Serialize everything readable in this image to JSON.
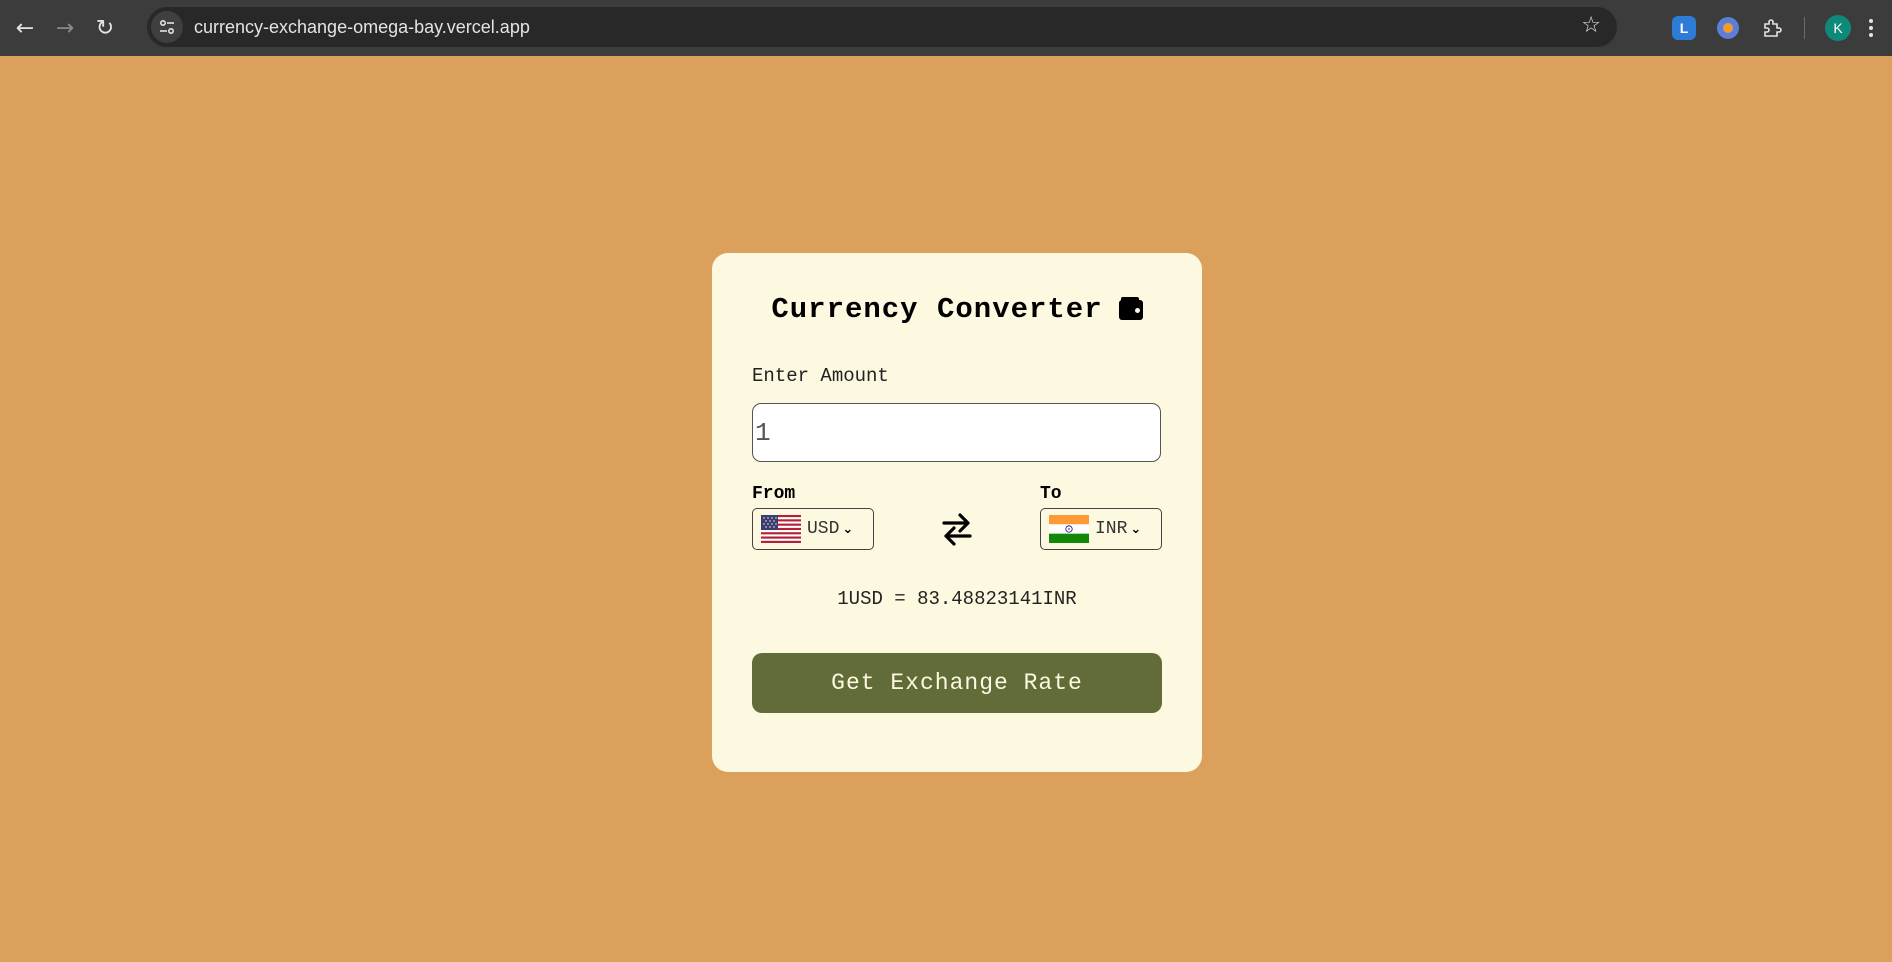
{
  "browser": {
    "url": "currency-exchange-omega-bay.vercel.app",
    "back_icon": "arrow-left-icon",
    "forward_icon": "arrow-right-icon",
    "reload_icon": "reload-icon",
    "bookmark_icon": "star-icon",
    "extensions": [
      "lastpass-icon",
      "extension-circle-icon",
      "puzzle-icon"
    ],
    "profile_initial": "K"
  },
  "colors": {
    "page_background": "#DBA05B",
    "card_background": "#FDF8E0",
    "button_background": "#626C38",
    "button_text": "#FDF8E0"
  },
  "converter": {
    "title": "Currency Converter",
    "title_icon": "wallet-icon",
    "amount_label": "Enter Amount",
    "amount_value": "1",
    "from_label": "From",
    "from_currency": "USD",
    "from_flag": "us-flag-icon",
    "to_label": "To",
    "to_currency": "INR",
    "to_flag": "india-flag-icon",
    "swap_icon": "swap-arrows-icon",
    "rate_message": "1USD = 83.48823141INR",
    "button_label": "Get Exchange Rate"
  }
}
